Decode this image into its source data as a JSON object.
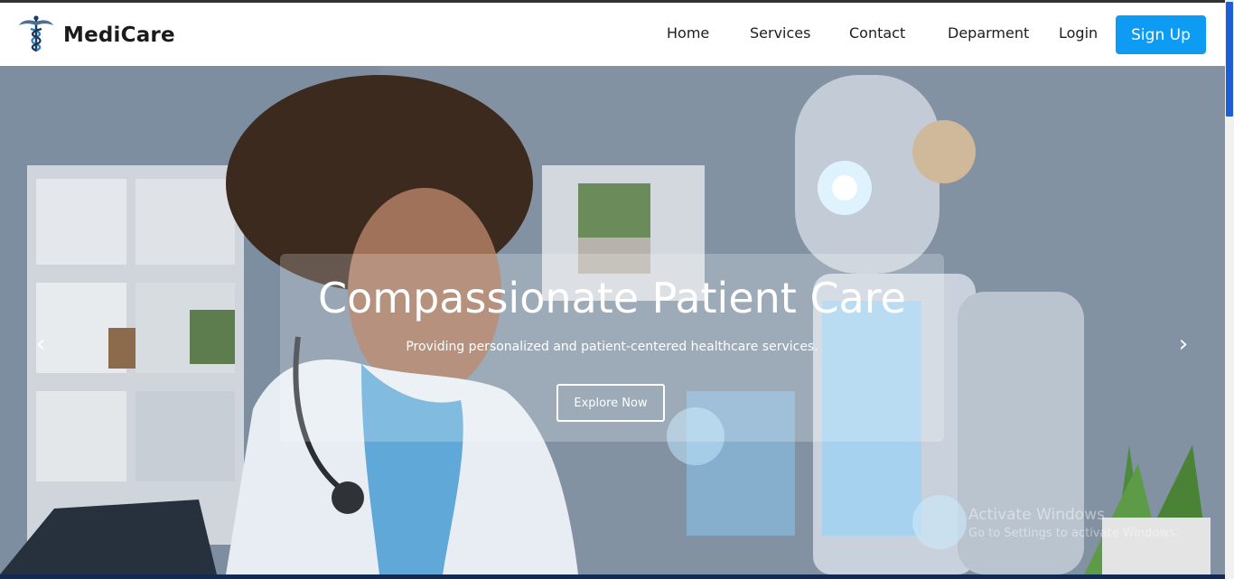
{
  "brand": {
    "name": "MediCare",
    "logo_icon": "caduceus-icon"
  },
  "nav": {
    "items": [
      "Home",
      "Services",
      "Contact",
      "Deparment",
      "Login"
    ],
    "signup_label": "Sign Up",
    "signup_color": "#0d9bf3"
  },
  "hero": {
    "title": "Compassionate Patient Care",
    "subtitle": "Providing personalized and patient-centered healthcare services.",
    "button_label": "Explore Now",
    "prev_icon": "chevron-left-icon",
    "next_icon": "chevron-right-icon",
    "prev_glyph": "‹",
    "next_glyph": "›"
  },
  "watermark": {
    "line1": "Activate Windows",
    "line2": "Go to Settings to activate Windows."
  }
}
